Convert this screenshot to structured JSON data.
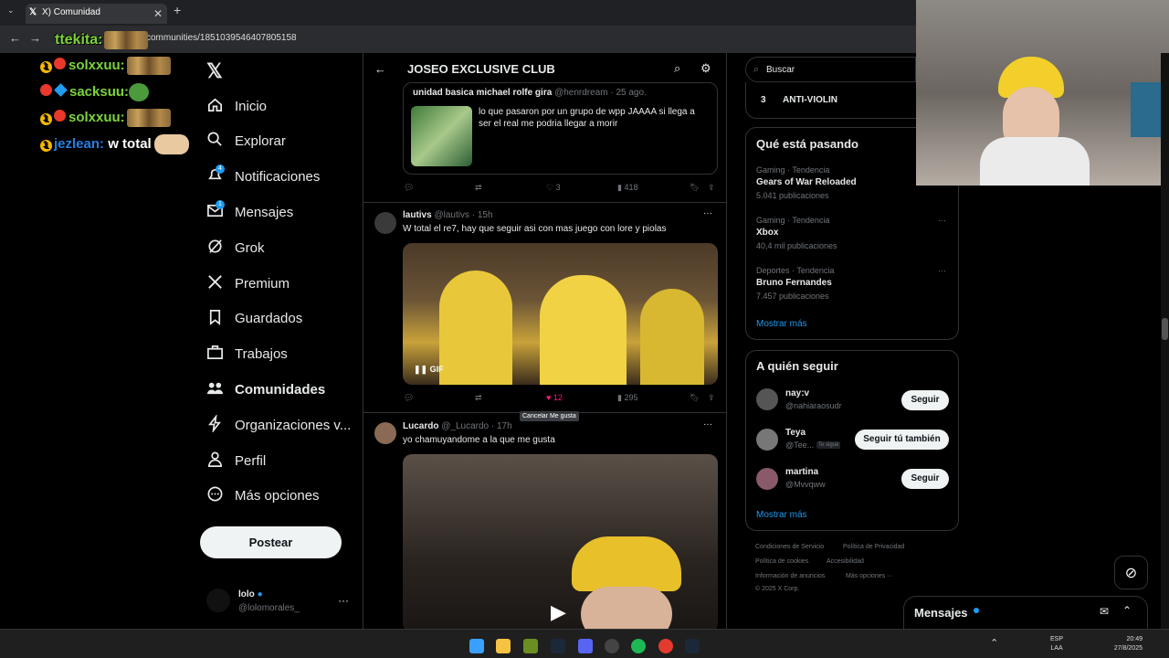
{
  "browser": {
    "tab_title": "X) Comunidad",
    "url": "communities/1851039546407805158"
  },
  "chat": [
    {
      "user": "solxxuu:",
      "color": "#7cd43a"
    },
    {
      "user": "sacksuu:",
      "color": "#7cd43a"
    },
    {
      "user": "solxxuu:",
      "color": "#7cd43a"
    },
    {
      "user": "jezlean:",
      "text": "w total",
      "color": "#2a7de1"
    }
  ],
  "chat_user_top": "ttekita:",
  "nav": {
    "items": [
      {
        "label": "Inicio",
        "icon": "home-icon"
      },
      {
        "label": "Explorar",
        "icon": "search-icon"
      },
      {
        "label": "Notificaciones",
        "icon": "bell-icon",
        "badge": "4"
      },
      {
        "label": "Mensajes",
        "icon": "mail-icon",
        "badge": "1"
      },
      {
        "label": "Grok",
        "icon": "grok-icon"
      },
      {
        "label": "Premium",
        "icon": "x-icon"
      },
      {
        "label": "Guardados",
        "icon": "bookmark-icon"
      },
      {
        "label": "Trabajos",
        "icon": "briefcase-icon"
      },
      {
        "label": "Comunidades",
        "icon": "communities-icon"
      },
      {
        "label": "Organizaciones v...",
        "icon": "lightning-icon"
      },
      {
        "label": "Perfil",
        "icon": "person-icon"
      },
      {
        "label": "Más opciones",
        "icon": "more-circle-icon"
      }
    ],
    "post_label": "Postear",
    "account_name": "lolo",
    "account_handle": "@lolomorales_"
  },
  "header": {
    "title": "JOSEO EXCLUSIVE CLUB"
  },
  "posts": [
    {
      "name": "unidad basica michael rolfe gira",
      "handle": "@henrdream",
      "time": "· 25 ago.",
      "text": "lo que pasaron por un grupo de wpp JAAAA si llega a",
      "text2": "ser el real me podria llegar a morir",
      "views": "418",
      "likes": "3"
    },
    {
      "name": "lautivs",
      "handle": "@lautivs",
      "time": "· 15h",
      "text": "W total el re7, hay que seguir asi con mas juego con lore y piolas",
      "gif_label": "GIF",
      "likes": "12",
      "views": "295",
      "tooltip": "Cancelar Me gusta"
    },
    {
      "name": "Lucardo",
      "handle": "@_Lucardo",
      "time": "· 17h",
      "text": "yo chamuyandome a la que me gusta"
    }
  ],
  "search": {
    "placeholder": "Buscar"
  },
  "community_rank": {
    "num": "3",
    "label": "ANTI-VIOLIN"
  },
  "trends": {
    "title": "Qué está pasando",
    "items": [
      {
        "cat": "Gaming · Tendencia",
        "name": "Gears of War Reloaded",
        "count": "5.041 publicaciones"
      },
      {
        "cat": "Gaming · Tendencia",
        "name": "Xbox",
        "count": "40,4 mil publicaciones"
      },
      {
        "cat": "Deportes · Tendencia",
        "name": "Bruno Fernandes",
        "count": "7.457 publicaciones"
      }
    ],
    "more": "Mostrar más"
  },
  "who_to_follow": {
    "title": "A quién seguir",
    "items": [
      {
        "name": "nay:v",
        "handle": "@nahiaraosudr",
        "button": "Seguir"
      },
      {
        "name": "Teya",
        "handle": "@Tee...",
        "tag": "Te sigue",
        "button": "Seguir tú también"
      },
      {
        "name": "martina",
        "handle": "@Mvvqww",
        "button": "Seguir"
      }
    ],
    "more": "Mostrar más"
  },
  "footer": {
    "l1a": "Condiciones de Servicio",
    "l1b": "Política de Privacidad",
    "l2a": "Política de cookies",
    "l2b": "Accesibilidad",
    "l3a": "Información de anuncios",
    "l3b": "Más opciones ···",
    "copyright": "© 2025 X Corp."
  },
  "messages_drawer": {
    "label": "Mensajes"
  },
  "taskbar": {
    "lang1": "ESP",
    "lang2": "LAA",
    "time": "20:49",
    "date": "27/8/2025"
  }
}
